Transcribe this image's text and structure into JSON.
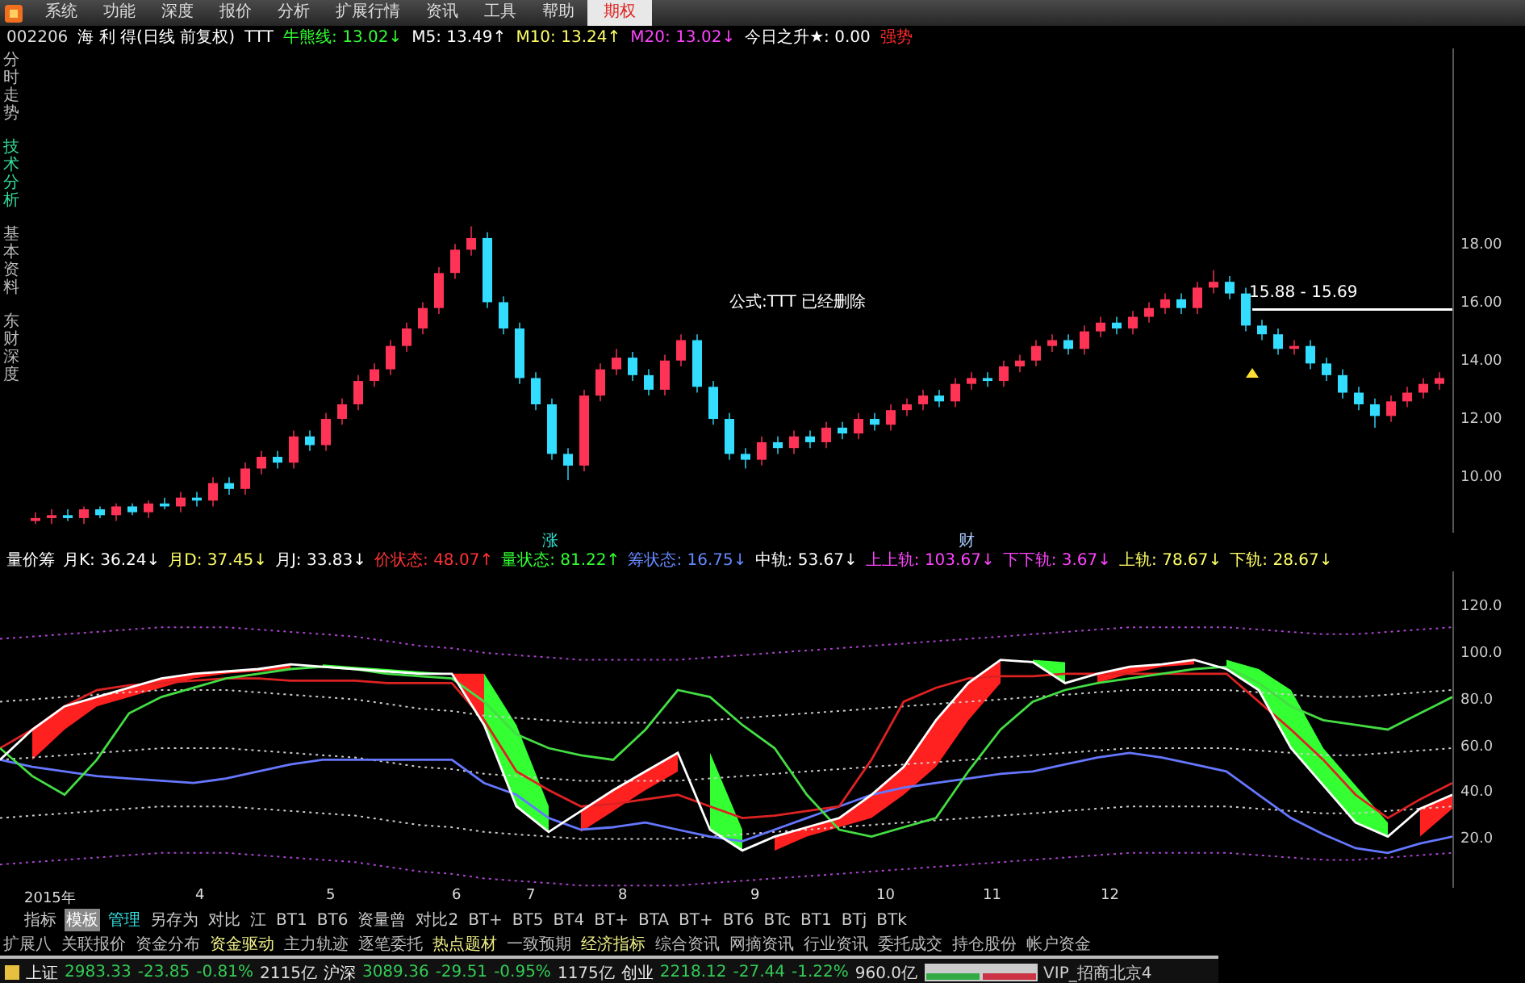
{
  "menu": {
    "items": [
      {
        "label": "系统",
        "selected": false
      },
      {
        "label": "功能",
        "selected": false
      },
      {
        "label": "深度",
        "selected": false
      },
      {
        "label": "报价",
        "selected": false
      },
      {
        "label": "分析",
        "selected": false
      },
      {
        "label": "扩展行情",
        "selected": false
      },
      {
        "label": "资讯",
        "selected": false
      },
      {
        "label": "工具",
        "selected": false
      },
      {
        "label": "帮助",
        "selected": false
      },
      {
        "label": "期权",
        "selected": true
      }
    ]
  },
  "quote_line": {
    "code": "002206",
    "name": "海 利 得(日线 前复权)",
    "formula": "TTT",
    "indicators": [
      {
        "label": "牛熊线:",
        "value": "13.02",
        "trend": "↓",
        "color": "#33ff33"
      },
      {
        "label": "M5:",
        "value": "13.49",
        "trend": "↑",
        "color": "#ffffff"
      },
      {
        "label": "M10:",
        "value": "13.24",
        "trend": "↑",
        "color": "#ffff66"
      },
      {
        "label": "M20:",
        "value": "13.02",
        "trend": "↓",
        "color": "#ff44ff"
      }
    ],
    "today": {
      "label": "今日之升★:",
      "value": "0.00"
    },
    "strength": "强势"
  },
  "side_tabs": [
    {
      "label": "分时走势",
      "selected": false
    },
    {
      "label": "技术分析",
      "selected": true
    },
    {
      "label": "基本资料",
      "selected": false
    },
    {
      "label": "东财深度",
      "selected": false
    }
  ],
  "price_chart": {
    "notice": "公式:TTT 已经删除",
    "range_label": "15.88 - 15.69",
    "chart_data": {
      "type": "candlestick",
      "ylim": [
        8.2,
        24.8
      ],
      "categories": [
        null,
        null,
        null,
        null,
        null,
        null,
        null,
        null,
        null,
        null,
        null,
        null,
        null,
        null,
        null,
        null,
        null,
        null,
        null,
        null,
        null,
        null,
        null,
        null,
        null,
        null,
        null,
        null,
        null,
        null,
        null,
        null,
        null,
        null,
        null,
        null,
        null,
        null,
        null,
        null,
        null,
        null,
        null,
        null,
        null,
        null,
        null,
        null,
        null,
        null,
        null,
        null,
        null,
        null,
        null,
        null,
        null,
        null,
        null,
        null,
        null,
        null,
        null,
        null,
        null,
        null,
        null,
        null,
        null,
        null,
        null,
        null,
        null,
        null,
        null,
        null,
        null,
        null,
        null,
        null,
        null,
        null,
        null,
        null,
        null,
        null,
        null,
        null
      ],
      "yticks": [
        {
          "value": 18,
          "label": "18.00"
        },
        {
          "value": 16,
          "label": "16.00"
        },
        {
          "value": 14,
          "label": "14.00"
        },
        {
          "value": 12,
          "label": "12.00"
        },
        {
          "value": 10,
          "label": "10.00"
        }
      ],
      "ohlc": [
        [
          8.6,
          8.9,
          8.5,
          8.7
        ],
        [
          8.7,
          9.0,
          8.5,
          8.8
        ],
        [
          8.8,
          9.0,
          8.6,
          8.7
        ],
        [
          8.7,
          9.1,
          8.5,
          9.0
        ],
        [
          9.0,
          9.1,
          8.7,
          8.8
        ],
        [
          8.8,
          9.2,
          8.6,
          9.1
        ],
        [
          9.1,
          9.2,
          8.8,
          8.9
        ],
        [
          8.9,
          9.3,
          8.7,
          9.2
        ],
        [
          9.2,
          9.4,
          9.0,
          9.1
        ],
        [
          9.1,
          9.6,
          8.9,
          9.4
        ],
        [
          9.4,
          9.6,
          9.1,
          9.3
        ],
        [
          9.3,
          10.1,
          9.1,
          9.9
        ],
        [
          9.9,
          10.1,
          9.5,
          9.7
        ],
        [
          9.7,
          10.6,
          9.5,
          10.4
        ],
        [
          10.4,
          11.0,
          10.2,
          10.8
        ],
        [
          10.8,
          11.0,
          10.4,
          10.6
        ],
        [
          10.6,
          11.7,
          10.4,
          11.5
        ],
        [
          11.5,
          11.7,
          11.0,
          11.2
        ],
        [
          11.2,
          12.3,
          11.0,
          12.1
        ],
        [
          12.1,
          12.8,
          11.9,
          12.6
        ],
        [
          12.6,
          13.6,
          12.4,
          13.4
        ],
        [
          13.4,
          14.0,
          13.2,
          13.8
        ],
        [
          13.8,
          14.8,
          13.6,
          14.6
        ],
        [
          14.6,
          15.4,
          14.4,
          15.2
        ],
        [
          15.2,
          16.1,
          15.0,
          15.9
        ],
        [
          15.9,
          17.3,
          15.7,
          17.1
        ],
        [
          17.1,
          18.1,
          16.9,
          17.9
        ],
        [
          17.9,
          18.7,
          17.7,
          18.3
        ],
        [
          18.3,
          18.5,
          15.9,
          16.1
        ],
        [
          16.1,
          16.3,
          15.0,
          15.2
        ],
        [
          15.2,
          15.4,
          13.3,
          13.5
        ],
        [
          13.5,
          13.7,
          12.4,
          12.6
        ],
        [
          12.6,
          12.8,
          10.7,
          10.9
        ],
        [
          10.9,
          11.1,
          10.0,
          10.5
        ],
        [
          10.5,
          13.1,
          10.3,
          12.9
        ],
        [
          12.9,
          14.0,
          12.7,
          13.8
        ],
        [
          13.8,
          14.5,
          13.6,
          14.2
        ],
        [
          14.2,
          14.4,
          13.4,
          13.6
        ],
        [
          13.6,
          13.8,
          12.9,
          13.1
        ],
        [
          13.1,
          14.3,
          12.9,
          14.1
        ],
        [
          14.1,
          15.0,
          13.9,
          14.8
        ],
        [
          14.8,
          15.0,
          13.0,
          13.2
        ],
        [
          13.2,
          13.4,
          11.9,
          12.1
        ],
        [
          12.1,
          12.3,
          10.7,
          10.9
        ],
        [
          10.9,
          11.1,
          10.4,
          10.7
        ],
        [
          10.7,
          11.5,
          10.5,
          11.3
        ],
        [
          11.3,
          11.5,
          10.9,
          11.1
        ],
        [
          11.1,
          11.7,
          10.9,
          11.5
        ],
        [
          11.5,
          11.7,
          11.1,
          11.3
        ],
        [
          11.3,
          12.0,
          11.1,
          11.8
        ],
        [
          11.8,
          12.0,
          11.4,
          11.6
        ],
        [
          11.6,
          12.3,
          11.4,
          12.1
        ],
        [
          12.1,
          12.3,
          11.7,
          11.9
        ],
        [
          11.9,
          12.6,
          11.7,
          12.4
        ],
        [
          12.4,
          12.8,
          12.2,
          12.6
        ],
        [
          12.6,
          13.1,
          12.4,
          12.9
        ],
        [
          12.9,
          13.1,
          12.5,
          12.7
        ],
        [
          12.7,
          13.5,
          12.5,
          13.3
        ],
        [
          13.3,
          13.7,
          13.1,
          13.5
        ],
        [
          13.5,
          13.7,
          13.2,
          13.4
        ],
        [
          13.4,
          14.1,
          13.2,
          13.9
        ],
        [
          13.9,
          14.3,
          13.7,
          14.1
        ],
        [
          14.1,
          14.8,
          13.9,
          14.6
        ],
        [
          14.6,
          15.0,
          14.4,
          14.8
        ],
        [
          14.8,
          15.0,
          14.3,
          14.5
        ],
        [
          14.5,
          15.3,
          14.3,
          15.1
        ],
        [
          15.1,
          15.6,
          14.9,
          15.4
        ],
        [
          15.4,
          15.6,
          15.0,
          15.2
        ],
        [
          15.2,
          15.8,
          15.0,
          15.6
        ],
        [
          15.6,
          16.1,
          15.4,
          15.9
        ],
        [
          15.9,
          16.4,
          15.7,
          16.2
        ],
        [
          16.2,
          16.4,
          15.7,
          15.9
        ],
        [
          15.9,
          16.8,
          15.7,
          16.6
        ],
        [
          16.6,
          17.2,
          16.4,
          16.8
        ],
        [
          16.8,
          17.0,
          16.2,
          16.4
        ],
        [
          16.4,
          16.6,
          15.1,
          15.3
        ],
        [
          15.3,
          15.5,
          14.8,
          15.0
        ],
        [
          15.0,
          15.2,
          14.3,
          14.5
        ],
        [
          14.5,
          14.8,
          14.3,
          14.6
        ],
        [
          14.6,
          14.8,
          13.8,
          14.0
        ],
        [
          14.0,
          14.2,
          13.4,
          13.6
        ],
        [
          13.6,
          13.8,
          12.8,
          13.0
        ],
        [
          13.0,
          13.2,
          12.4,
          12.6
        ],
        [
          12.6,
          12.8,
          11.8,
          12.2
        ],
        [
          12.2,
          12.9,
          12.0,
          12.7
        ],
        [
          12.7,
          13.2,
          12.5,
          13.0
        ],
        [
          13.0,
          13.5,
          12.8,
          13.3
        ],
        [
          13.3,
          13.7,
          13.1,
          13.5
        ]
      ]
    }
  },
  "markers": [
    "涨",
    "财"
  ],
  "indicator_header": {
    "name": "量价筹",
    "values": [
      {
        "label": "月K:",
        "value": "36.24",
        "trend": "↓",
        "color": "#ffffff"
      },
      {
        "label": "月D:",
        "value": "37.45",
        "trend": "↓",
        "color": "#ffff66"
      },
      {
        "label": "月J:",
        "value": "33.83",
        "trend": "↓",
        "color": "#ffffff"
      },
      {
        "label": "价状态:",
        "value": "48.07",
        "trend": "↑",
        "color": "#ff3333"
      },
      {
        "label": "量状态:",
        "value": "81.22",
        "trend": "↑",
        "color": "#33ff33"
      },
      {
        "label": "筹状态:",
        "value": "16.75",
        "trend": "↓",
        "color": "#6688ff"
      },
      {
        "label": "中轨:",
        "value": "53.67",
        "trend": "↓",
        "color": "#ffffff"
      },
      {
        "label": "上上轨:",
        "value": "103.67",
        "trend": "↓",
        "color": "#ff44ff"
      },
      {
        "label": "下下轨:",
        "value": "3.67",
        "trend": "↓",
        "color": "#ff44ff"
      },
      {
        "label": "上轨:",
        "value": "78.67",
        "trend": "↓",
        "color": "#ffff66"
      },
      {
        "label": "下轨:",
        "value": "28.67",
        "trend": "↓",
        "color": "#ffff66"
      }
    ]
  },
  "indicator_chart": {
    "chart_data": {
      "type": "line",
      "ylim": [
        0,
        136
      ],
      "yticks": [
        {
          "value": 120,
          "label": "120.0"
        },
        {
          "value": 100,
          "label": "100.0"
        },
        {
          "value": 80,
          "label": "80.0"
        },
        {
          "value": 60,
          "label": "60.0"
        },
        {
          "value": 40,
          "label": "40.0"
        },
        {
          "value": 20,
          "label": "20.0"
        }
      ],
      "series": [
        {
          "line_style": "dotted",
          "color": "#aa44cc",
          "values": [
            107,
            108,
            109,
            110,
            111,
            112,
            112,
            112,
            111,
            110,
            109,
            108,
            106,
            104,
            103,
            101,
            100,
            99,
            98,
            98,
            98,
            98,
            99,
            100,
            101,
            102,
            103,
            104,
            105,
            106,
            107,
            108,
            109,
            110,
            111,
            112,
            112,
            112,
            112,
            111,
            110,
            109,
            109,
            110,
            111,
            112
          ]
        },
        {
          "line_style": "dotted",
          "color": "#cccccc",
          "values": [
            80,
            81,
            82,
            83,
            84,
            85,
            85,
            85,
            84,
            83,
            82,
            81,
            79,
            77,
            76,
            74,
            73,
            72,
            71,
            71,
            71,
            71,
            72,
            73,
            74,
            75,
            76,
            77,
            78,
            79,
            80,
            81,
            82,
            83,
            84,
            85,
            85,
            85,
            85,
            84,
            83,
            82,
            82,
            83,
            84,
            85
          ]
        },
        {
          "line_style": "dotted",
          "color": "#cccccc",
          "values": [
            55,
            56,
            57,
            58,
            59,
            60,
            60,
            60,
            59,
            58,
            57,
            56,
            54,
            52,
            51,
            49,
            48,
            47,
            46,
            46,
            46,
            46,
            47,
            48,
            49,
            50,
            51,
            52,
            53,
            54,
            55,
            56,
            57,
            58,
            59,
            60,
            60,
            60,
            60,
            59,
            58,
            57,
            57,
            58,
            59,
            60
          ]
        },
        {
          "line_style": "dotted",
          "color": "#cccccc",
          "values": [
            30,
            31,
            32,
            33,
            34,
            35,
            35,
            35,
            34,
            33,
            32,
            31,
            29,
            27,
            26,
            24,
            23,
            22,
            21,
            21,
            21,
            21,
            22,
            23,
            24,
            25,
            26,
            27,
            28,
            29,
            30,
            31,
            32,
            33,
            34,
            35,
            35,
            35,
            35,
            34,
            33,
            32,
            32,
            33,
            34,
            35
          ]
        },
        {
          "line_style": "dotted",
          "color": "#aa44cc",
          "values": [
            10,
            11,
            12,
            13,
            14,
            15,
            15,
            15,
            14,
            13,
            12,
            11,
            9,
            7,
            6,
            4,
            3,
            2,
            1,
            1,
            1,
            1,
            2,
            3,
            4,
            5,
            6,
            7,
            8,
            9,
            10,
            11,
            12,
            13,
            14,
            15,
            15,
            15,
            15,
            14,
            13,
            12,
            12,
            13,
            14,
            15
          ]
        },
        {
          "color": "#6677ff",
          "values": [
            55,
            52,
            50,
            48,
            47,
            46,
            45,
            47,
            50,
            53,
            55,
            55,
            55,
            55,
            55,
            45,
            40,
            30,
            25,
            26,
            28,
            25,
            22,
            20,
            25,
            30,
            35,
            40,
            43,
            45,
            47,
            49,
            50,
            53,
            56,
            58,
            56,
            53,
            50,
            40,
            30,
            23,
            17,
            15,
            19,
            22
          ]
        },
        {
          "color": "#dd2222",
          "values": [
            60,
            68,
            78,
            85,
            87,
            88,
            89,
            90,
            90,
            89,
            89,
            89,
            88,
            88,
            88,
            72,
            50,
            42,
            35,
            36,
            38,
            40,
            35,
            30,
            31,
            33,
            35,
            55,
            80,
            86,
            90,
            91,
            91,
            92,
            92,
            92,
            92,
            92,
            92,
            80,
            68,
            55,
            40,
            30,
            38,
            45
          ]
        },
        {
          "color": "#44dd44",
          "values": [
            60,
            48,
            40,
            55,
            75,
            82,
            86,
            90,
            92,
            94,
            95,
            94,
            92,
            91,
            90,
            80,
            66,
            60,
            57,
            55,
            68,
            85,
            82,
            70,
            60,
            40,
            25,
            22,
            26,
            30,
            50,
            68,
            80,
            85,
            88,
            90,
            92,
            94,
            95,
            88,
            78,
            72,
            70,
            68,
            75,
            82
          ]
        },
        {
          "color": "#ffffff",
          "values": [
            55,
            68,
            78,
            82,
            86,
            90,
            92,
            93,
            94,
            96,
            95,
            94,
            93,
            92,
            92,
            70,
            35,
            24,
            33,
            42,
            50,
            58,
            25,
            16,
            22,
            26,
            30,
            40,
            52,
            72,
            88,
            98,
            97,
            88,
            92,
            95,
            96,
            98,
            94,
            85,
            60,
            44,
            28,
            22,
            34,
            40
          ]
        }
      ]
    }
  },
  "x_axis": [
    "2015年",
    "4",
    "5",
    "6",
    "7",
    "8",
    "9",
    "10",
    "11",
    "12"
  ],
  "template_tabs": [
    {
      "label": "指标",
      "selected": false
    },
    {
      "label": "模板",
      "selected": true
    },
    {
      "label": "管理",
      "selected": false
    },
    {
      "label": "另存为",
      "selected": false
    },
    {
      "label": "对比",
      "selected": false
    },
    {
      "label": "江",
      "selected": false
    },
    {
      "label": "BT1",
      "selected": false
    },
    {
      "label": "BT6",
      "selected": false
    },
    {
      "label": "资量曾",
      "selected": false
    },
    {
      "label": "对比2",
      "selected": false
    },
    {
      "label": "BT+",
      "selected": false
    },
    {
      "label": "BT5",
      "selected": false
    },
    {
      "label": "BT4",
      "selected": false
    },
    {
      "label": "BT+",
      "selected": false
    },
    {
      "label": "BTA",
      "selected": false
    },
    {
      "label": "BT+",
      "selected": false
    },
    {
      "label": "BT6",
      "selected": false
    },
    {
      "label": "BTc",
      "selected": false
    },
    {
      "label": "BT1",
      "selected": false
    },
    {
      "label": "BTj",
      "selected": false
    },
    {
      "label": "BTk",
      "selected": false
    }
  ],
  "extension_tabs": [
    {
      "label": "扩展八",
      "selected": false
    },
    {
      "label": "关联报价",
      "selected": false
    },
    {
      "label": "资金分布",
      "selected": false
    },
    {
      "label": "资金驱动",
      "selected": true
    },
    {
      "label": "主力轨迹",
      "selected": false
    },
    {
      "label": "逐笔委托",
      "selected": false
    },
    {
      "label": "热点题材",
      "selected": true
    },
    {
      "label": "一致预期",
      "selected": false
    },
    {
      "label": "经济指标",
      "selected": true
    },
    {
      "label": "综合资讯",
      "selected": false
    },
    {
      "label": "网摘资讯",
      "selected": false
    },
    {
      "label": "行业资讯",
      "selected": false
    },
    {
      "label": "委托成交",
      "selected": false
    },
    {
      "label": "持仓股份",
      "selected": false
    },
    {
      "label": "帐户资金",
      "selected": false
    }
  ],
  "status_bar": {
    "indices": [
      {
        "name": "上证",
        "value": "2983.33",
        "change": "-23.85",
        "percent": "-0.81%",
        "volume": "2115亿"
      },
      {
        "name": "沪深",
        "value": "3089.36",
        "change": "-29.51",
        "percent": "-0.95%",
        "volume": "1175亿"
      },
      {
        "name": "创业",
        "value": "2218.12",
        "change": "-27.44",
        "percent": "-1.22%",
        "volume": "960.0亿"
      }
    ],
    "account": "VIP_招商北京4"
  }
}
